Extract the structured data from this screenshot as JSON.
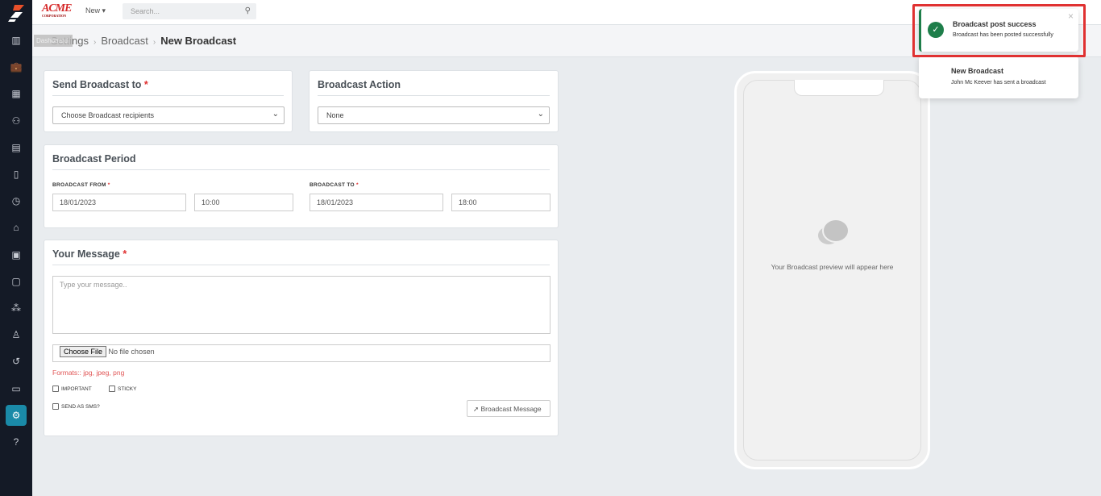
{
  "topbar": {
    "brand": "ACME",
    "brand_sub": "CORPORATION",
    "new_label": "New",
    "search_placeholder": "Search..."
  },
  "sidebar": {
    "tooltip": "Dashboard",
    "items": [
      "dashboard-icon",
      "briefcase-icon",
      "calendar-icon",
      "users-icon",
      "building-icon",
      "map-icon",
      "clock-icon",
      "tag-icon",
      "calculator-icon",
      "clipboard-icon",
      "cubes-icon",
      "user-icon",
      "history-icon",
      "monitor-icon",
      "gear-icon",
      "help-icon"
    ],
    "active_index": 14
  },
  "breadcrumb": [
    "Settings",
    "Broadcast",
    "New Broadcast"
  ],
  "send_to": {
    "title": "Send Broadcast to",
    "placeholder": "Choose Broadcast recipients"
  },
  "action": {
    "title": "Broadcast Action",
    "value": "None"
  },
  "period": {
    "title": "Broadcast Period",
    "from_label": "BROADCAST FROM",
    "to_label": "BROADCAST TO",
    "from_date": "18/01/2023",
    "from_time": "10:00",
    "to_date": "18/01/2023",
    "to_time": "18:00"
  },
  "message": {
    "title": "Your Message",
    "placeholder": "Type your message..",
    "choose_file": "Choose File",
    "no_file": "No file chosen",
    "formats": "Formats:: jpg, jpeg, png",
    "important": "IMPORTANT",
    "sticky": "STICKY",
    "sms": "SEND AS SMS?",
    "submit": "Broadcast Message"
  },
  "preview": {
    "text": "Your Broadcast preview will appear here"
  },
  "toasts": [
    {
      "title": "Broadcast post success",
      "body": "Broadcast has been posted successfully"
    },
    {
      "title": "New Broadcast",
      "body": "John Mc Keever has sent a broadcast"
    }
  ],
  "colors": {
    "success": "#1e7e4a",
    "accent": "#1a8aa8",
    "highlight": "#e03131"
  }
}
